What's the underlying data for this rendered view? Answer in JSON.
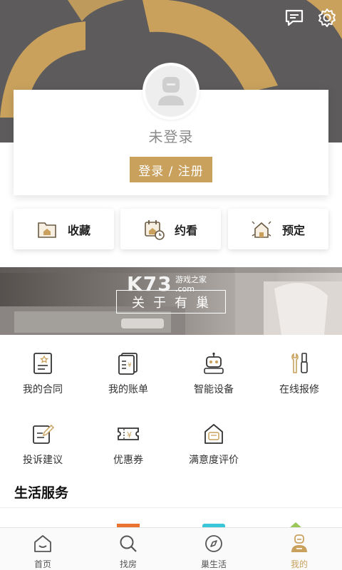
{
  "profile": {
    "username": "未登录",
    "login_label": "登录 / 注册"
  },
  "quick_actions": [
    {
      "label": "收藏",
      "icon": "favorites-icon"
    },
    {
      "label": "约看",
      "icon": "appointment-icon"
    },
    {
      "label": "预定",
      "icon": "reserve-icon"
    }
  ],
  "banner": {
    "text": "关于有巢",
    "watermark": "K73",
    "watermark_sub1": "游戏之家",
    "watermark_sub2": ".com"
  },
  "services": [
    {
      "label": "我的合同",
      "icon": "contract-icon"
    },
    {
      "label": "我的账单",
      "icon": "bill-icon"
    },
    {
      "label": "智能设备",
      "icon": "robot-icon"
    },
    {
      "label": "在线报修",
      "icon": "repair-tools-icon"
    },
    {
      "label": "投诉建议",
      "icon": "complaint-icon"
    },
    {
      "label": "优惠券",
      "icon": "coupon-icon"
    },
    {
      "label": "满意度评价",
      "icon": "rating-icon"
    }
  ],
  "life_services": {
    "title": "生活服务"
  },
  "tabs": [
    {
      "label": "首页",
      "icon": "home-icon",
      "active": false
    },
    {
      "label": "找房",
      "icon": "search-icon",
      "active": false
    },
    {
      "label": "巢生活",
      "icon": "compass-icon",
      "active": false
    },
    {
      "label": "我的",
      "icon": "profile-icon",
      "active": true
    }
  ],
  "colors": {
    "accent": "#c9a15d",
    "header_bg": "#5d5b5c",
    "deco_gold": "#c9a15d"
  }
}
